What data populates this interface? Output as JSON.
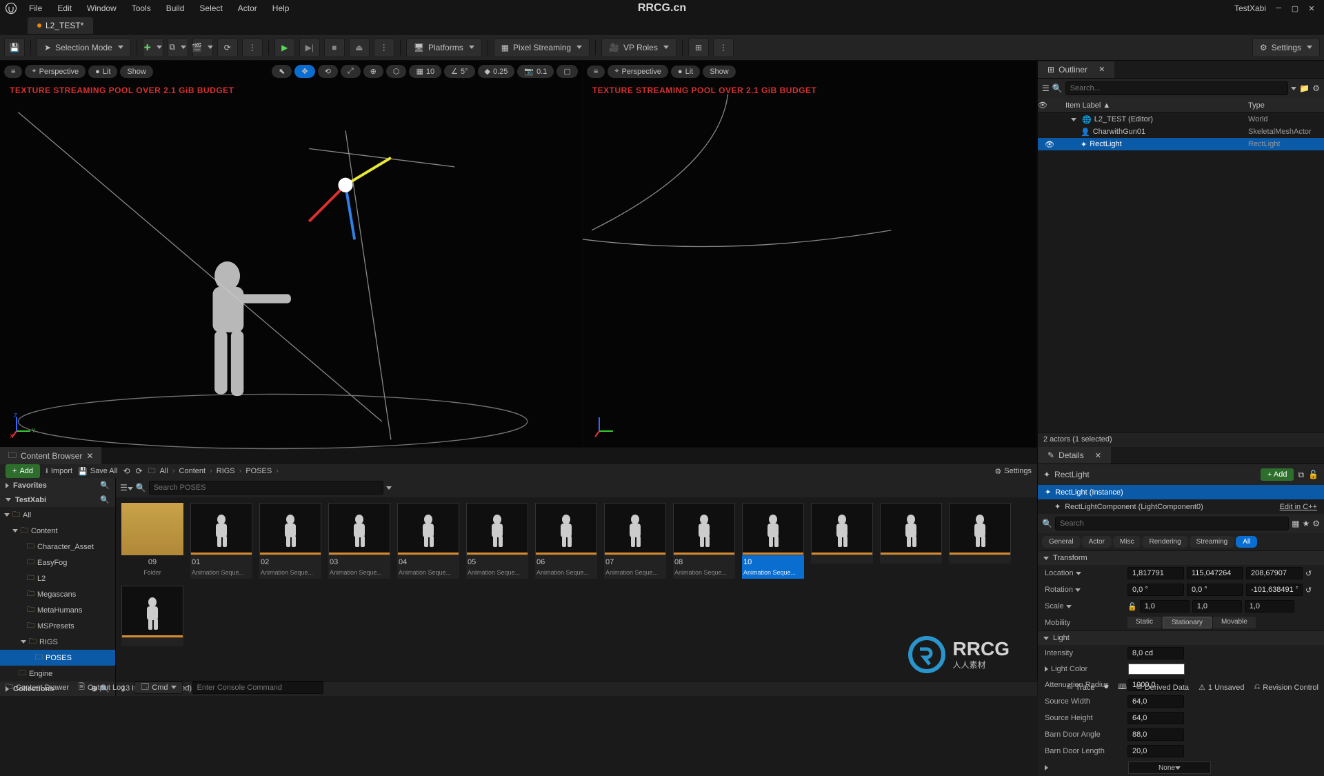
{
  "app": {
    "center_title": "RRCG.cn",
    "project_name": "TestXabi",
    "active_tab": "L2_TEST*"
  },
  "menu": [
    "File",
    "Edit",
    "Window",
    "Tools",
    "Build",
    "Select",
    "Actor",
    "Help"
  ],
  "toolbar": {
    "selection_mode": "Selection Mode",
    "platforms": "Platforms",
    "pixel_streaming": "Pixel Streaming",
    "vp_roles": "VP Roles",
    "settings": "Settings"
  },
  "viewport": {
    "perspective": "Perspective",
    "lit": "Lit",
    "show": "Show",
    "grid_size": "10",
    "angle_snap": "5°",
    "scale_snap": "0.25",
    "cam_speed": "0.1",
    "warning": "TEXTURE STREAMING POOL OVER 2.1 GiB BUDGET"
  },
  "outliner": {
    "title": "Outliner",
    "search_placeholder": "Search...",
    "header_item": "Item Label",
    "header_type": "Type",
    "rows": [
      {
        "indent": 1,
        "icon": "world",
        "label": "L2_TEST (Editor)",
        "type": "World",
        "vis": ""
      },
      {
        "indent": 2,
        "icon": "skmesh",
        "label": "CharwithGun01",
        "type": "SkeletalMeshActor",
        "vis": ""
      },
      {
        "indent": 2,
        "icon": "light",
        "label": "RectLight",
        "type": "RectLight",
        "vis": "eye",
        "selected": true
      }
    ],
    "status": "2 actors (1 selected)"
  },
  "details": {
    "title": "Details",
    "actor_name": "RectLight",
    "add_label": "+ Add",
    "components": [
      {
        "label": "RectLight (Instance)",
        "selected": true
      },
      {
        "label": "RectLightComponent (LightComponent0)",
        "edit": "Edit in C++"
      }
    ],
    "search_placeholder": "Search",
    "filters": [
      "General",
      "Actor",
      "Misc",
      "Rendering",
      "Streaming",
      "All"
    ],
    "active_filter": "All",
    "transform": {
      "label": "Transform",
      "location_label": "Location",
      "rotation_label": "Rotation",
      "scale_label": "Scale",
      "mobility_label": "Mobility",
      "location": [
        "1,817791",
        "115,047264",
        "208,67907"
      ],
      "rotation": [
        "0,0 °",
        "0,0 °",
        "-101,638491 °"
      ],
      "scale": [
        "1,0",
        "1,0",
        "1,0"
      ],
      "mobility_options": [
        "Static",
        "Stationary",
        "Movable"
      ],
      "mobility_active": "Stationary"
    },
    "light": {
      "label": "Light",
      "intensity_label": "Intensity",
      "intensity": "8,0 cd",
      "light_color_label": "Light Color",
      "attenuation_label": "Attenuation Radius",
      "attenuation": "1000,0",
      "source_width_label": "Source Width",
      "source_width": "64,0",
      "source_height_label": "Source Height",
      "source_height": "64,0",
      "barn_angle_label": "Barn Door Angle",
      "barn_angle": "88,0",
      "barn_length_label": "Barn Door Length",
      "barn_length": "20,0",
      "dropdown": "None"
    }
  },
  "content_browser": {
    "title": "Content Browser",
    "add": "Add",
    "import": "Import",
    "save_all": "Save All",
    "settings": "Settings",
    "breadcrumb": [
      "All",
      "Content",
      "RIGS",
      "POSES"
    ],
    "favorites": "Favorites",
    "project": "TestXabi",
    "collections": "Collections",
    "search_placeholder": "Search POSES",
    "tree": [
      {
        "indent": 0,
        "label": "All",
        "open": true
      },
      {
        "indent": 1,
        "label": "Content",
        "open": true
      },
      {
        "indent": 2,
        "label": "Character_Asset"
      },
      {
        "indent": 2,
        "label": "EasyFog"
      },
      {
        "indent": 2,
        "label": "L2"
      },
      {
        "indent": 2,
        "label": "Megascans"
      },
      {
        "indent": 2,
        "label": "MetaHumans"
      },
      {
        "indent": 2,
        "label": "MSPresets"
      },
      {
        "indent": 2,
        "label": "RIGS",
        "open": true
      },
      {
        "indent": 3,
        "label": "POSES",
        "selected": true
      },
      {
        "indent": 1,
        "label": "Engine"
      }
    ],
    "items": [
      {
        "name": "09",
        "type": "Folder",
        "folder": true
      },
      {
        "name": "01",
        "type": "Animation Seque..."
      },
      {
        "name": "02",
        "type": "Animation Seque..."
      },
      {
        "name": "03",
        "type": "Animation Seque..."
      },
      {
        "name": "04",
        "type": "Animation Seque..."
      },
      {
        "name": "05",
        "type": "Animation Seque..."
      },
      {
        "name": "06",
        "type": "Animation Seque..."
      },
      {
        "name": "07",
        "type": "Animation Seque..."
      },
      {
        "name": "08",
        "type": "Animation Seque..."
      },
      {
        "name": "10",
        "type": "Animation Seque...",
        "selected": true
      },
      {
        "name": "",
        "type": ""
      },
      {
        "name": "",
        "type": ""
      },
      {
        "name": "",
        "type": ""
      },
      {
        "name": "",
        "type": ""
      }
    ],
    "status": "13 items (1 selected)"
  },
  "statusbar": {
    "content_drawer": "Content Drawer",
    "output_log": "Output Log",
    "cmd_label": "Cmd",
    "cmd_placeholder": "Enter Console Command",
    "trace": "Trace",
    "derived_data": "Derived Data",
    "unsaved": "1 Unsaved",
    "revision": "Revision Control"
  },
  "watermark": {
    "main": "RRCG",
    "sub": "人人素材"
  },
  "colors": {
    "accent": "#0a6ed1",
    "green": "#2d6e2d",
    "warn": "#d73030"
  }
}
